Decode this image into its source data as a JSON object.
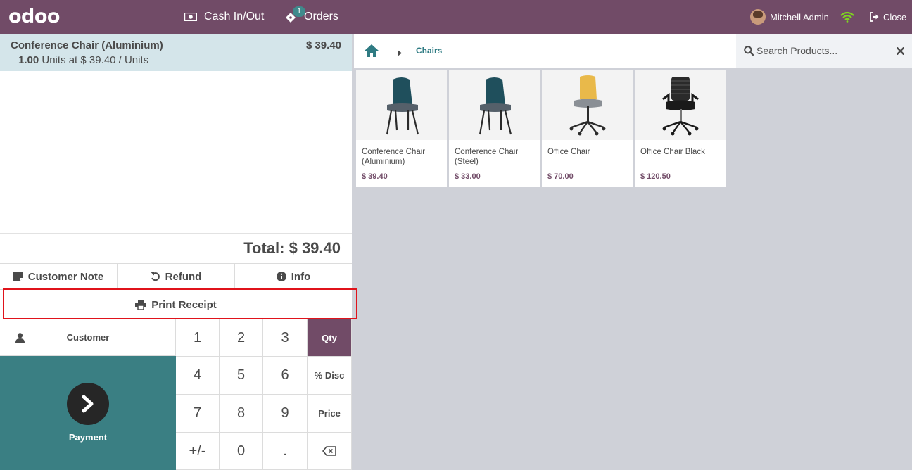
{
  "header": {
    "logo": "odoo",
    "cash_label": "Cash In/Out",
    "orders_label": "Orders",
    "orders_badge": "1",
    "user_name": "Mitchell Admin",
    "close_label": "Close",
    "brand_color": "#714b67"
  },
  "order": {
    "line": {
      "name": "Conference Chair (Aluminium)",
      "price": "$ 39.40",
      "qty": "1.00",
      "info": "Units at $ 39.40 / Units"
    },
    "total": "Total: $ 39.40"
  },
  "controls": {
    "customer_note": "Customer Note",
    "refund": "Refund",
    "info": "Info",
    "print_receipt": "Print Receipt"
  },
  "actionpad": {
    "customer": "Customer",
    "payment": "Payment",
    "payment_color": "#3a7f83"
  },
  "numpad": {
    "keys": [
      "1",
      "2",
      "3",
      "Qty",
      "4",
      "5",
      "6",
      "% Disc",
      "7",
      "8",
      "9",
      "Price",
      "+/-",
      "0",
      ".",
      "backspace-icon"
    ],
    "active_mode": "Qty"
  },
  "breadcrumb": {
    "category": "Chairs"
  },
  "search": {
    "placeholder": "Search Products..."
  },
  "products": [
    {
      "name": "Conference Chair (Aluminium)",
      "price": "$ 39.40",
      "icon": "teal-chair-image"
    },
    {
      "name": "Conference Chair (Steel)",
      "price": "$ 33.00",
      "icon": "teal-chair-image"
    },
    {
      "name": "Office Chair",
      "price": "$ 70.00",
      "icon": "yellow-office-chair-image"
    },
    {
      "name": "Office Chair Black",
      "price": "$ 120.50",
      "icon": "black-office-chair-image"
    }
  ]
}
